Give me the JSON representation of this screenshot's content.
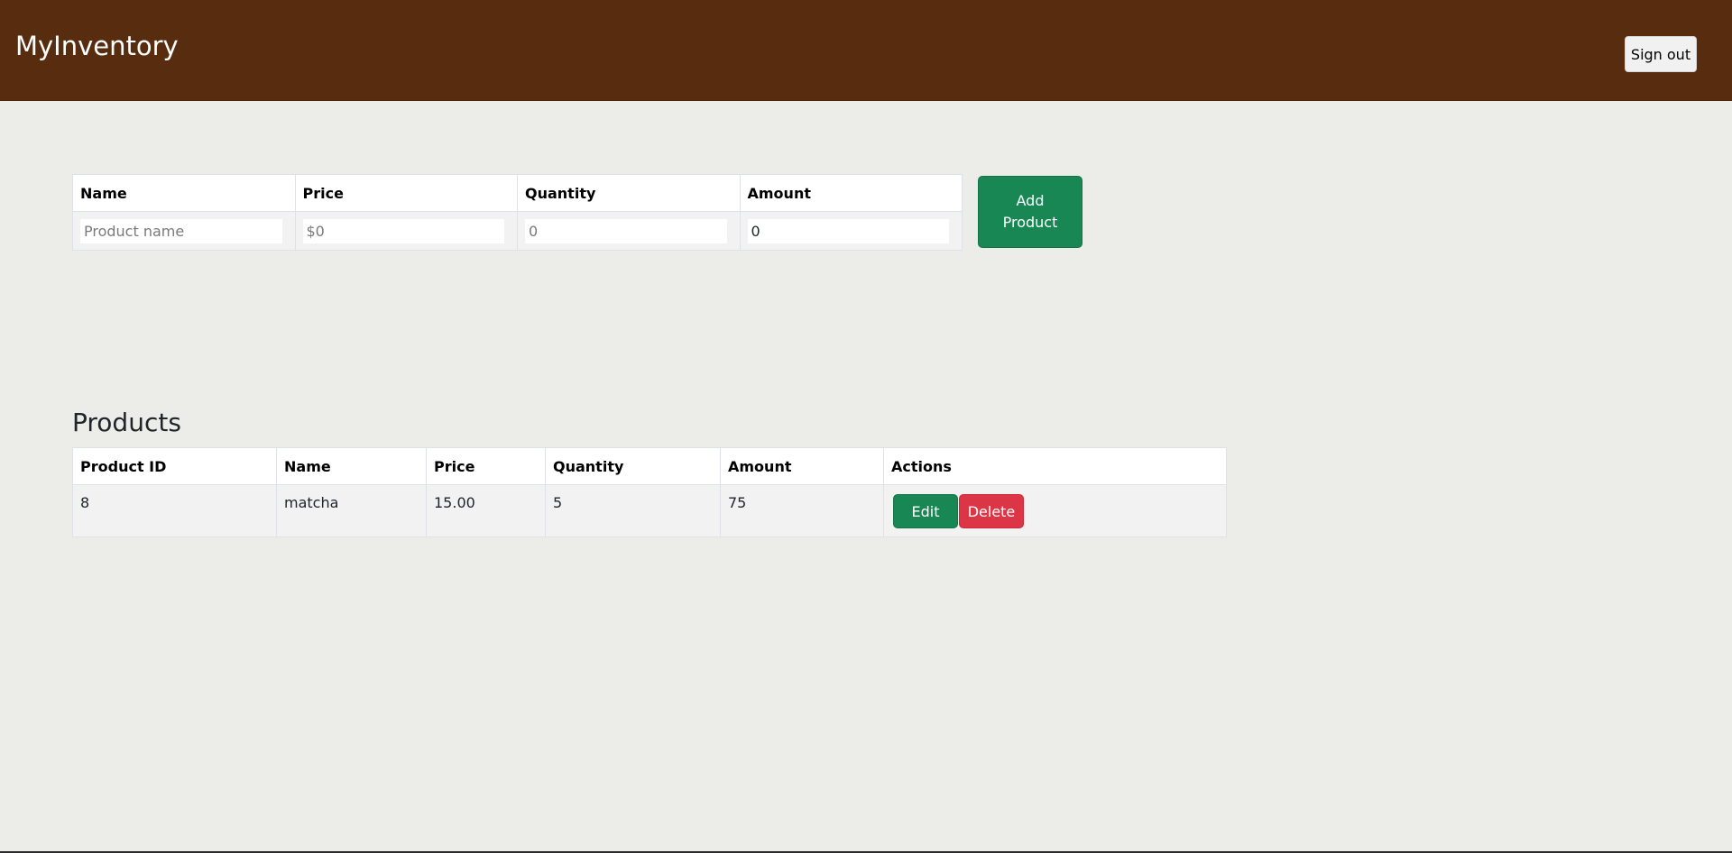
{
  "app": {
    "brand": "MyInventory",
    "sign_out_label": "Sign out"
  },
  "add_form": {
    "headers": [
      "Name",
      "Price",
      "Quantity",
      "Amount"
    ],
    "fields": {
      "name": {
        "value": "",
        "placeholder": "Product name"
      },
      "price": {
        "value": "",
        "placeholder": "$0"
      },
      "quantity": {
        "value": "",
        "placeholder": "0"
      },
      "amount": {
        "value": "0",
        "placeholder": ""
      }
    },
    "submit_label": "Add Product"
  },
  "products": {
    "title": "Products",
    "headers": [
      "Product ID",
      "Name",
      "Price",
      "Quantity",
      "Amount",
      "Actions"
    ],
    "rows": [
      {
        "id": "8",
        "name": "matcha",
        "price": "15.00",
        "quantity": "5",
        "amount": "75"
      }
    ],
    "edit_label": "Edit",
    "delete_label": "Delete"
  },
  "colors": {
    "navbar": "#582d0f",
    "background": "#ecede8",
    "success": "#198754",
    "danger": "#dc3545"
  }
}
